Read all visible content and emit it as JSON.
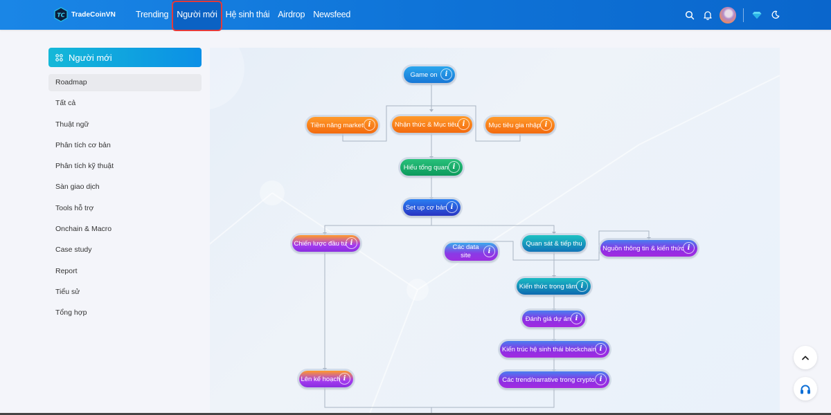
{
  "header": {
    "brand": "TradeCoinVN",
    "nav": [
      {
        "label": "Trending",
        "active": false
      },
      {
        "label": "Người mới",
        "active": true
      },
      {
        "label": "Hệ sinh thái",
        "active": false
      },
      {
        "label": "Airdrop",
        "active": false
      },
      {
        "label": "Newsfeed",
        "active": false
      }
    ],
    "icons": [
      "search-icon",
      "bell-icon",
      "avatar",
      "diamond-icon",
      "moon-icon"
    ]
  },
  "sidebar": {
    "title": "Người mới",
    "title_icon": "grid-icon",
    "items": [
      {
        "label": "Roadmap",
        "active": true
      },
      {
        "label": "Tất cả"
      },
      {
        "label": "Thuật ngữ"
      },
      {
        "label": "Phân tích cơ bản"
      },
      {
        "label": "Phân tích kỹ thuật"
      },
      {
        "label": "Sàn giao dịch"
      },
      {
        "label": "Tools hỗ trợ"
      },
      {
        "label": "Onchain & Macro"
      },
      {
        "label": "Case study"
      },
      {
        "label": "Report"
      },
      {
        "label": "Tiểu sử"
      },
      {
        "label": "Tổng hợp"
      }
    ]
  },
  "roadmap": {
    "info_glyph": "i",
    "nodes": {
      "game_on": "Game on",
      "tiem_nang": "Tiềm năng market",
      "nhan_thuc": "Nhận thức & Mục tiêu",
      "muc_tieu": "Mục tiêu gia nhập",
      "hieu_tong_quan": "Hiểu tổng quan",
      "setup": "Set up cơ bản",
      "chien_luoc": "Chiến lược đầu tư",
      "data_site": "Các data site",
      "quan_sat": "Quan sát & tiếp thu",
      "nguon_thong_tin": "Nguồn thông tin & kiến thức",
      "kien_thuc": "Kiến thức trọng tâm",
      "danh_gia": "Đánh giá dự án",
      "kien_truc": "Kiến trúc hệ sinh thái blockchain",
      "trend": "Các trend/narrative trong crypto",
      "ke_hoach": "Lên kế hoạch"
    }
  },
  "floating": {
    "scroll_top_icon": "chevron-up-icon",
    "support_icon": "headphones-icon"
  }
}
